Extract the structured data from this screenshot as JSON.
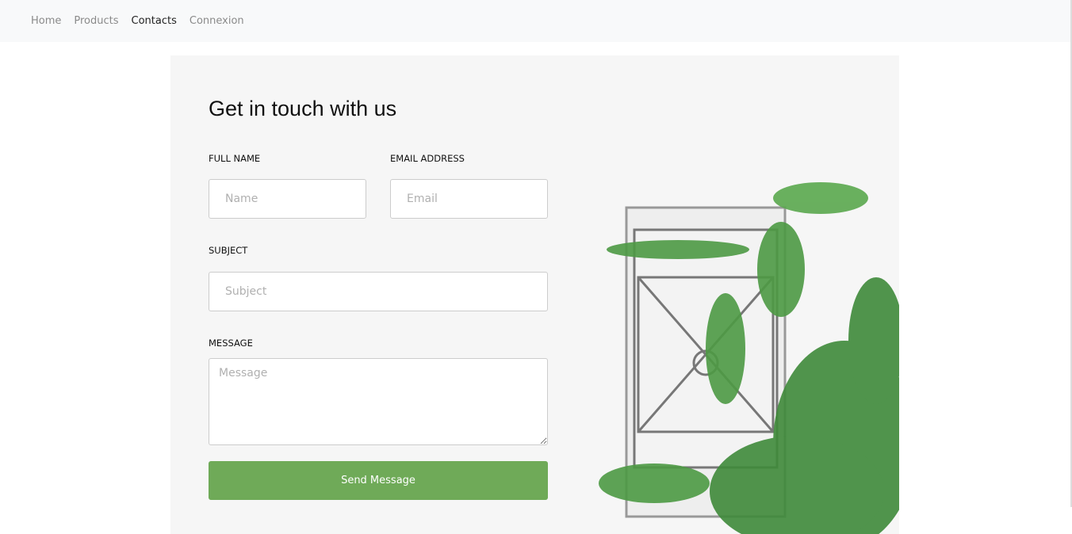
{
  "nav": {
    "items": [
      {
        "label": "Home"
      },
      {
        "label": "Products"
      },
      {
        "label": "Contacts",
        "active": true
      },
      {
        "label": "Connexion"
      }
    ]
  },
  "form": {
    "title": "Get in touch with us",
    "full_name": {
      "label": "FULL NAME",
      "placeholder": "Name",
      "value": ""
    },
    "email": {
      "label": "EMAIL ADDRESS",
      "placeholder": "Email",
      "value": ""
    },
    "subject": {
      "label": "SUBJECT",
      "placeholder": "Subject",
      "value": ""
    },
    "message": {
      "label": "MESSAGE",
      "placeholder": "Message",
      "value": ""
    },
    "submit_label": "Send Message"
  },
  "colors": {
    "accent": "#6faa58",
    "nav_bg": "#f8f9fa"
  },
  "image": {
    "subject": "window-with-ivy-photo"
  }
}
